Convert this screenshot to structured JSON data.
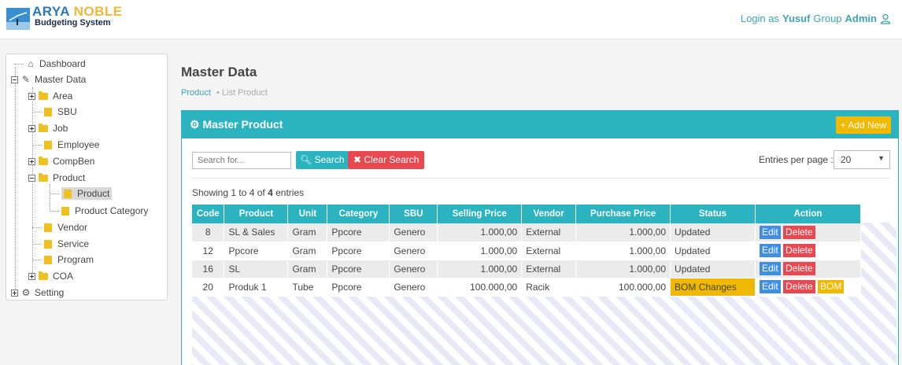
{
  "header": {
    "logo_word1": "ARYA",
    "logo_word2": "NOBLE",
    "logo_subtitle": "Budgeting System",
    "login_prefix": "Login as",
    "login_user": "Yusuf",
    "login_group": "Group",
    "login_role": "Admin"
  },
  "tree": {
    "dashboard": "Dashboard",
    "master_data": "Master Data",
    "area": "Area",
    "sbu": "SBU",
    "job": "Job",
    "employee": "Employee",
    "compben": "CompBen",
    "product": "Product",
    "product_leaf": "Product",
    "product_category": "Product Category",
    "vendor": "Vendor",
    "service": "Service",
    "program": "Program",
    "coa": "COA",
    "setting": "Setting"
  },
  "page": {
    "title": "Master Data",
    "breadcrumb_1": "Product",
    "breadcrumb_2": "List Product"
  },
  "panel": {
    "title": "Master Product",
    "add_new": "Add New",
    "search_placeholder": "Search for...",
    "search_button": "Search",
    "clear_button": "Clear Search",
    "entries_label": "Entries per page :",
    "entries_value": "20",
    "showing_prefix": "Showing 1 to 4 of",
    "showing_total": "4",
    "showing_suffix": "entries"
  },
  "table": {
    "headers": [
      "Code",
      "Product",
      "Unit",
      "Category",
      "SBU",
      "Selling Price",
      "Vendor",
      "Purchase Price",
      "Status",
      "Action"
    ],
    "rows": [
      {
        "code": "8",
        "product": "SL & Sales",
        "unit": "Gram",
        "category": "Ppcore",
        "sbu": "Genero",
        "selling": "1.000,00",
        "vendor": "External",
        "purchase": "1.000,00",
        "status": "Updated"
      },
      {
        "code": "12",
        "product": "Ppcore",
        "unit": "Gram",
        "category": "Ppcore",
        "sbu": "Genero",
        "selling": "1.000,00",
        "vendor": "External",
        "purchase": "1.000,00",
        "status": "Updated"
      },
      {
        "code": "16",
        "product": "SL",
        "unit": "Gram",
        "category": "Ppcore",
        "sbu": "Genero",
        "selling": "1.000,00",
        "vendor": "External",
        "purchase": "1.000,00",
        "status": "Updated"
      },
      {
        "code": "20",
        "product": "Produk 1",
        "unit": "Tube",
        "category": "Ppcore",
        "sbu": "Genero",
        "selling": "100.000,00",
        "vendor": "Racik",
        "purchase": "100.000,00",
        "status": "BOM Changes"
      }
    ],
    "edit_label": "Edit",
    "delete_label": "Delete",
    "bom_label": "BOM"
  },
  "colors": {
    "accent": "#2bb3c0",
    "warning": "#f0b800",
    "danger": "#e8484f",
    "primary": "#3f8ee0"
  }
}
